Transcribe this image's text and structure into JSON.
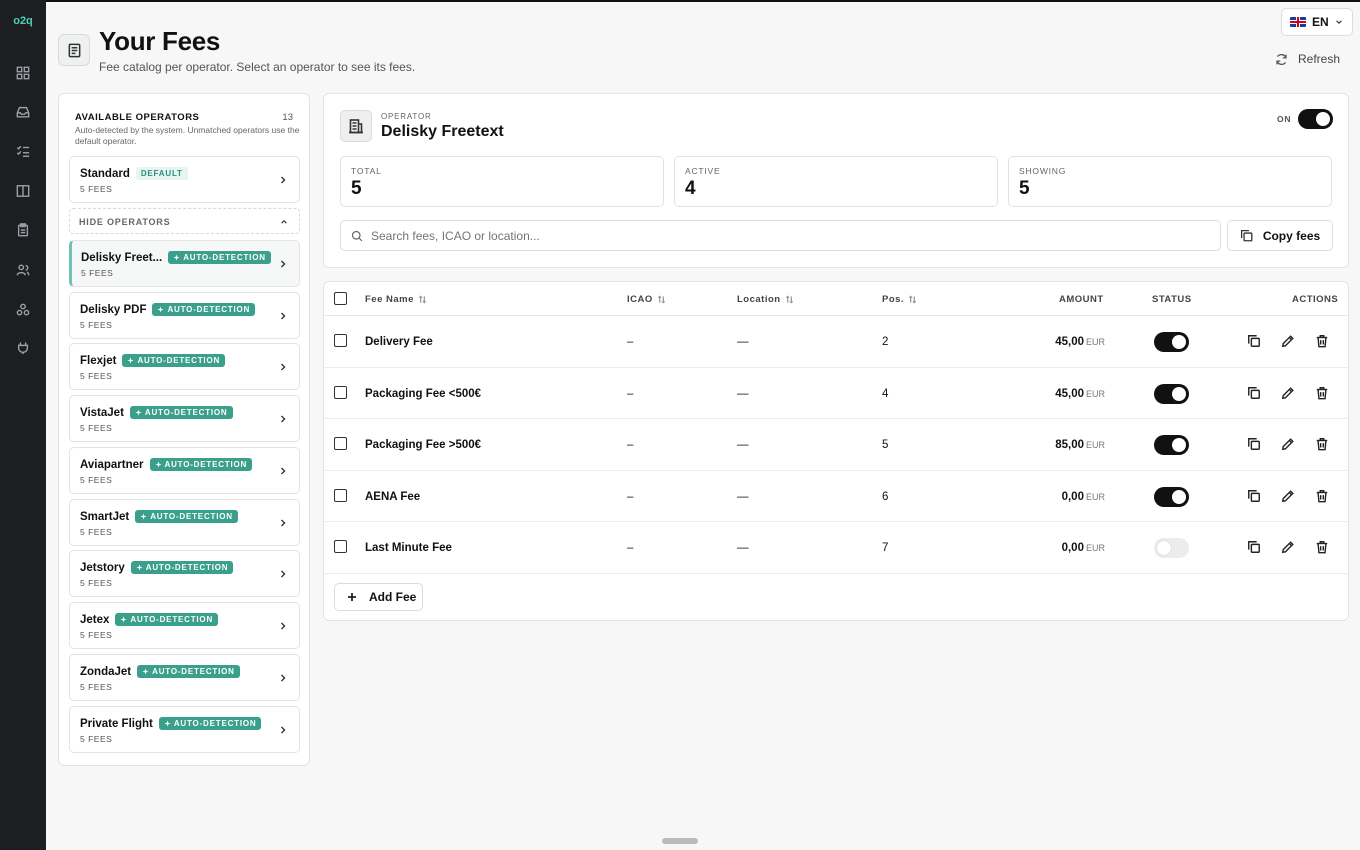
{
  "rail": {
    "logo": "o2q",
    "icons": [
      "dashboard-icon",
      "inbox-icon",
      "checklist-icon",
      "book-icon",
      "clipboard-icon",
      "users-icon",
      "network-icon",
      "plug-icon"
    ]
  },
  "header": {
    "title": "Your Fees",
    "subtitle": "Fee catalog per operator. Select an operator to see its fees.",
    "language": "EN",
    "refresh_label": "Refresh"
  },
  "operators_panel": {
    "title": "AVAILABLE OPERATORS",
    "count": "13",
    "description": "Auto-detected by the system. Unmatched operators use the default operator.",
    "default_operator": {
      "name": "Standard",
      "badge": "DEFAULT",
      "fees": "5 FEES"
    },
    "hide_label": "HIDE OPERATORS",
    "items": [
      {
        "name": "Delisky Freet...",
        "badge": "AUTO-DETECTION",
        "fees": "5 FEES",
        "active": true
      },
      {
        "name": "Delisky PDF",
        "badge": "AUTO-DETECTION",
        "fees": "5 FEES"
      },
      {
        "name": "Flexjet",
        "badge": "AUTO-DETECTION",
        "fees": "5 FEES"
      },
      {
        "name": "VistaJet",
        "badge": "AUTO-DETECTION",
        "fees": "5 FEES"
      },
      {
        "name": "Aviapartner",
        "badge": "AUTO-DETECTION",
        "fees": "5 FEES"
      },
      {
        "name": "SmartJet",
        "badge": "AUTO-DETECTION",
        "fees": "5 FEES"
      },
      {
        "name": "Jetstory",
        "badge": "AUTO-DETECTION",
        "fees": "5 FEES"
      },
      {
        "name": "Jetex",
        "badge": "AUTO-DETECTION",
        "fees": "5 FEES"
      },
      {
        "name": "ZondaJet",
        "badge": "AUTO-DETECTION",
        "fees": "5 FEES"
      },
      {
        "name": "Private Flight",
        "badge": "AUTO-DETECTION",
        "fees": "5 FEES"
      }
    ]
  },
  "operator": {
    "label": "OPERATOR",
    "name": "Delisky Freetext",
    "toggle_label": "ON",
    "enabled": true,
    "stats": [
      {
        "label": "TOTAL",
        "value": "5"
      },
      {
        "label": "ACTIVE",
        "value": "4"
      },
      {
        "label": "SHOWING",
        "value": "5"
      }
    ],
    "search_placeholder": "Search fees, ICAO or location...",
    "copy_label": "Copy fees"
  },
  "table": {
    "columns": {
      "name": "Fee Name",
      "icao": "ICAO",
      "location": "Location",
      "pos": "Pos.",
      "amount": "AMOUNT",
      "status": "STATUS",
      "actions": "ACTIONS"
    },
    "rows": [
      {
        "name": "Delivery Fee",
        "icao": "–",
        "location": "—",
        "pos": "2",
        "amount": "45,00",
        "currency": "EUR",
        "active": true
      },
      {
        "name": "Packaging Fee <500€",
        "icao": "–",
        "location": "—",
        "pos": "4",
        "amount": "45,00",
        "currency": "EUR",
        "active": true
      },
      {
        "name": "Packaging Fee >500€",
        "icao": "–",
        "location": "—",
        "pos": "5",
        "amount": "85,00",
        "currency": "EUR",
        "active": true
      },
      {
        "name": "AENA Fee",
        "icao": "–",
        "location": "—",
        "pos": "6",
        "amount": "0,00",
        "currency": "EUR",
        "active": true
      },
      {
        "name": "Last Minute Fee",
        "icao": "–",
        "location": "—",
        "pos": "7",
        "amount": "0,00",
        "currency": "EUR",
        "active": false
      }
    ],
    "add_label": "Add Fee"
  }
}
